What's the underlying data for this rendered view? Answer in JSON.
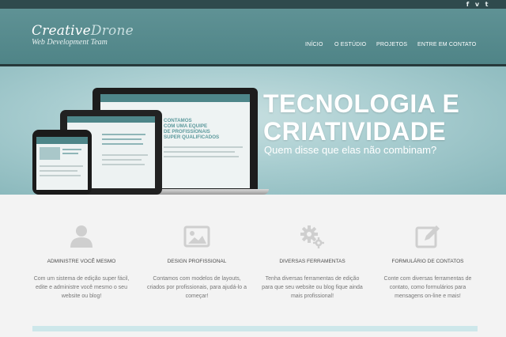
{
  "social": [
    {
      "icon": "facebook-icon",
      "glyph": "f"
    },
    {
      "icon": "vimeo-icon",
      "glyph": "v"
    },
    {
      "icon": "twitter-icon",
      "glyph": "t"
    }
  ],
  "logo": {
    "part1": "Creative",
    "part2": "Drone",
    "tagline": "Web Development Team"
  },
  "nav": [
    {
      "label": "INÍCIO"
    },
    {
      "label": "O ESTÚDIO"
    },
    {
      "label": "PROJETOS"
    },
    {
      "label": "ENTRE EM CONTATO"
    }
  ],
  "hero": {
    "title_line1": "TECNOLOGIA E",
    "title_line2": "CRIATIVIDADE",
    "subtitle": "Quem disse que elas não combinam?",
    "screen_text": "CONTAMOS\nCOM UMA EQUIPE\nDE PROFISSIONAIS\nSUPER QUALIFICADOS"
  },
  "features": [
    {
      "icon": "user-icon",
      "title": "ADMINISTRE VOCÊ MESMO",
      "desc": "Com um sistema de edição super fácil, edite e administre você mesmo o seu website ou blog!"
    },
    {
      "icon": "picture-icon",
      "title": "DESIGN PROFISSIONAL",
      "desc": "Contamos com modelos de layouts, criados por profissionais, para ajudá-lo a começar!"
    },
    {
      "icon": "gears-icon",
      "title": "DIVERSAS FERRAMENTAS",
      "desc": "Tenha diversas ferramentas de edição para que seu website ou blog fique ainda mais profissional!"
    },
    {
      "icon": "edit-form-icon",
      "title": "FORMULÁRIO DE CONTATOS",
      "desc": "Conte com diversas ferramentas de contato, como formulários para mensagens on-line e mais!"
    }
  ],
  "colors": {
    "header": "#5a8d90",
    "accent": "#4e8689",
    "hero_bg": "#a8cdd0"
  }
}
